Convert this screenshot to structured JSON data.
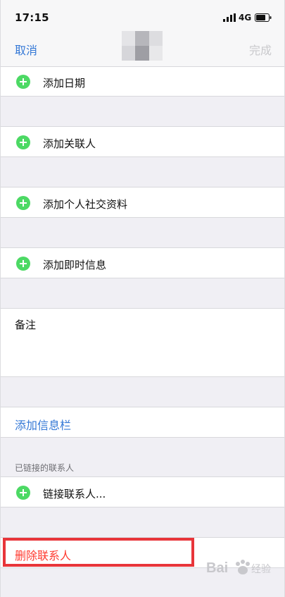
{
  "status_bar": {
    "time": "17:15",
    "network": "4G",
    "icons": [
      "signal-icon",
      "battery-icon"
    ]
  },
  "nav": {
    "cancel_label": "取消",
    "done_label": "完成",
    "accent_color": "#3478d6",
    "disabled_color": "#c9c9cc"
  },
  "rows": {
    "add_date": "添加日期",
    "add_related": "添加关联人",
    "add_social": "添加个人社交资料",
    "add_im": "添加即时信息",
    "notes": "备注",
    "add_field": "添加信息栏",
    "linked_header": "已链接的联系人",
    "link_contact": "链接联系人...",
    "delete_contact": "删除联系人"
  },
  "colors": {
    "add_icon": "#4cd964",
    "delete": "#ff3b30",
    "highlight": "#e8353a"
  }
}
